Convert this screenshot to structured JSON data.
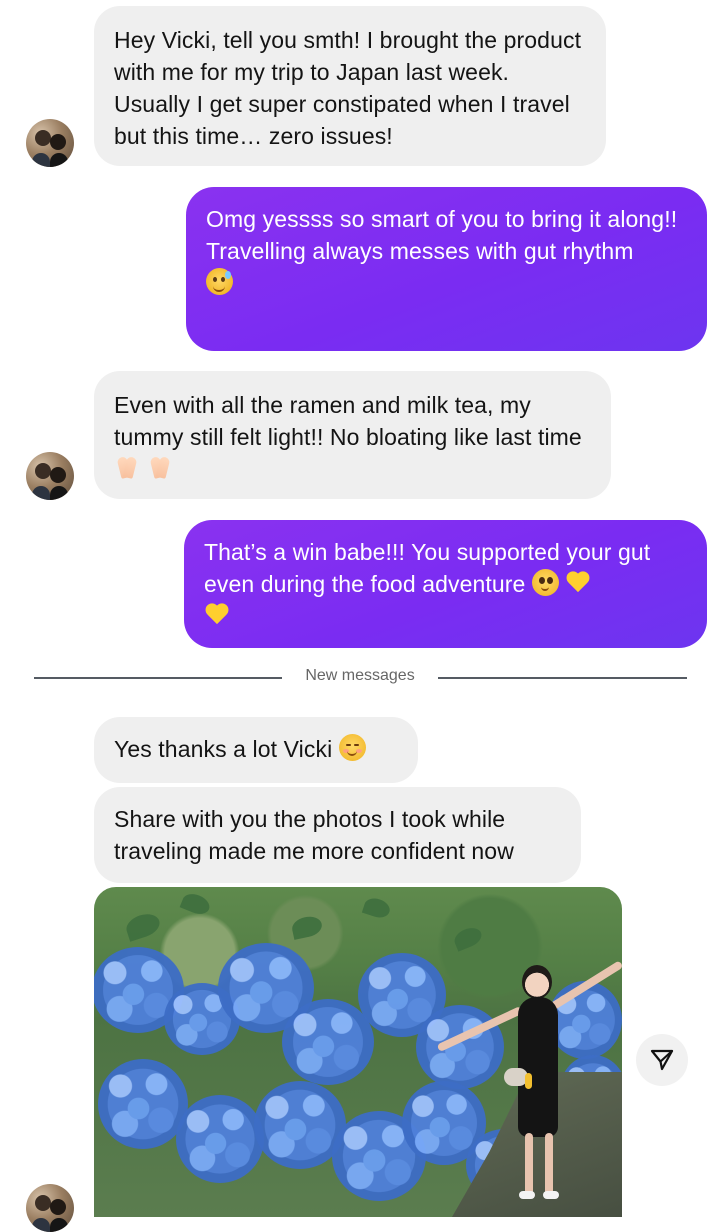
{
  "thread": {
    "messages": [
      {
        "text": "Hey Vicki, tell you smth! I brought the product with me for my trip to Japan last week. Usually I get super constipated when I travel but this time… zero issues!"
      },
      {
        "text": "Omg yessss so smart of you to bring it along!!\nTravelling always messes with gut rhythm"
      },
      {
        "text": "Even with all the ramen and milk tea, my tummy still felt light!! No bloating like last time"
      },
      {
        "text": "That’s a win babe!!! You supported your gut even during the food adventure"
      },
      {
        "text": "Yes thanks a lot Vicki"
      },
      {
        "text": "Share with you the photos I took while traveling made me more confident now"
      }
    ],
    "divider": {
      "label": "New messages"
    }
  },
  "icons": {
    "avatar": "avatar",
    "share": "send-icon",
    "sweat_emoji": "grinning-sweat-emoji",
    "pray_emoji": "folded-hands-emoji",
    "pleading_emoji": "pleading-face-emoji",
    "heart_emoji": "yellow-heart-emoji",
    "smile_emoji": "smiling-face-emoji"
  }
}
